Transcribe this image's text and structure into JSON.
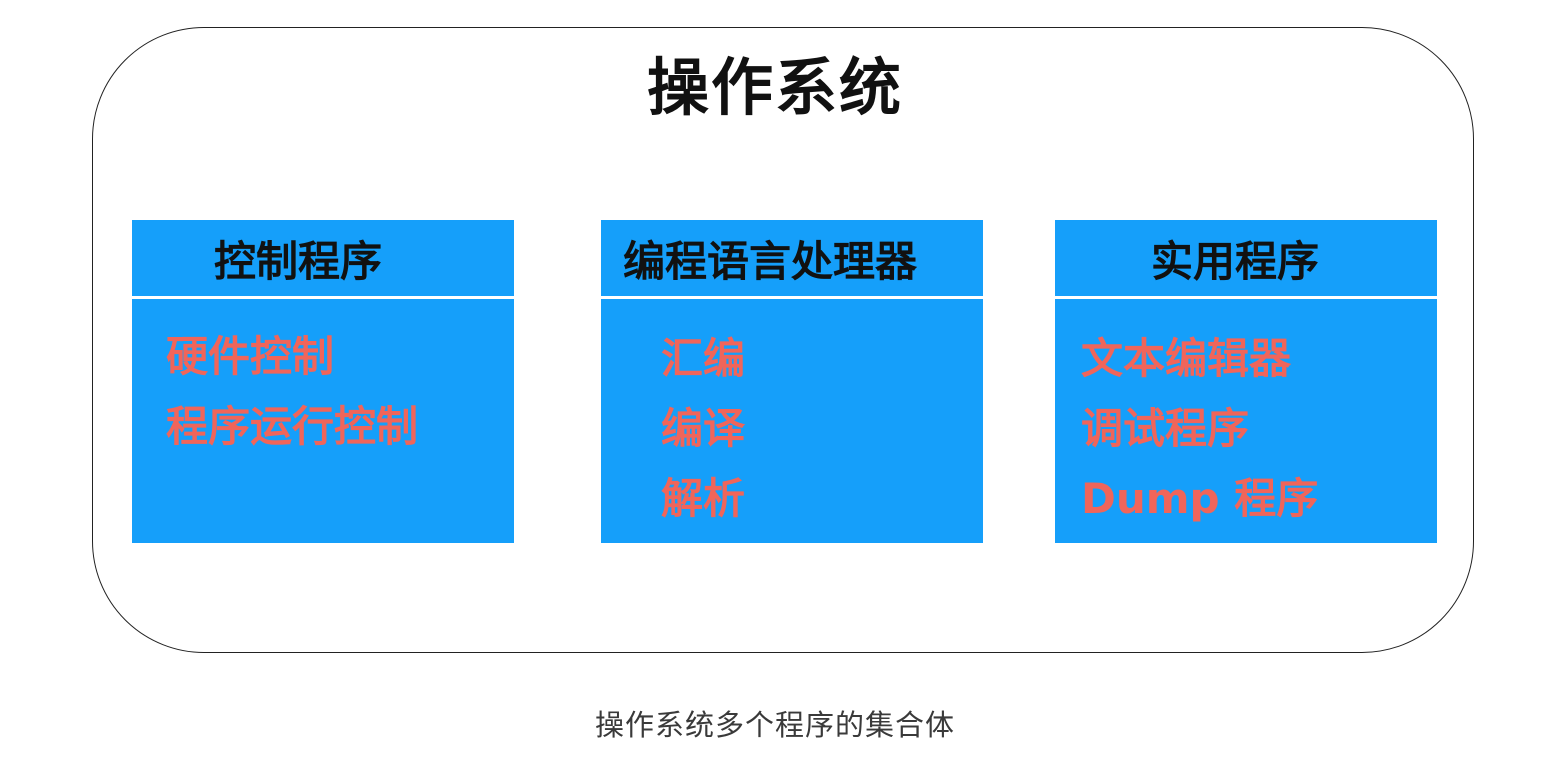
{
  "colors": {
    "panel_fill": "#159ffa",
    "item_text": "#f0655a",
    "header_text": "#111111",
    "frame_border": "#222222"
  },
  "diagram": {
    "title": "操作系统",
    "panels": [
      {
        "header": "控制程序",
        "items": [
          "硬件控制",
          "程序运行控制"
        ]
      },
      {
        "header": "编程语言处理器",
        "items": [
          "汇编",
          "编译",
          "解析"
        ]
      },
      {
        "header": "实用程序",
        "items": [
          "文本编辑器",
          "调试程序",
          "Dump 程序"
        ]
      }
    ]
  },
  "caption": "操作系统多个程序的集合体"
}
